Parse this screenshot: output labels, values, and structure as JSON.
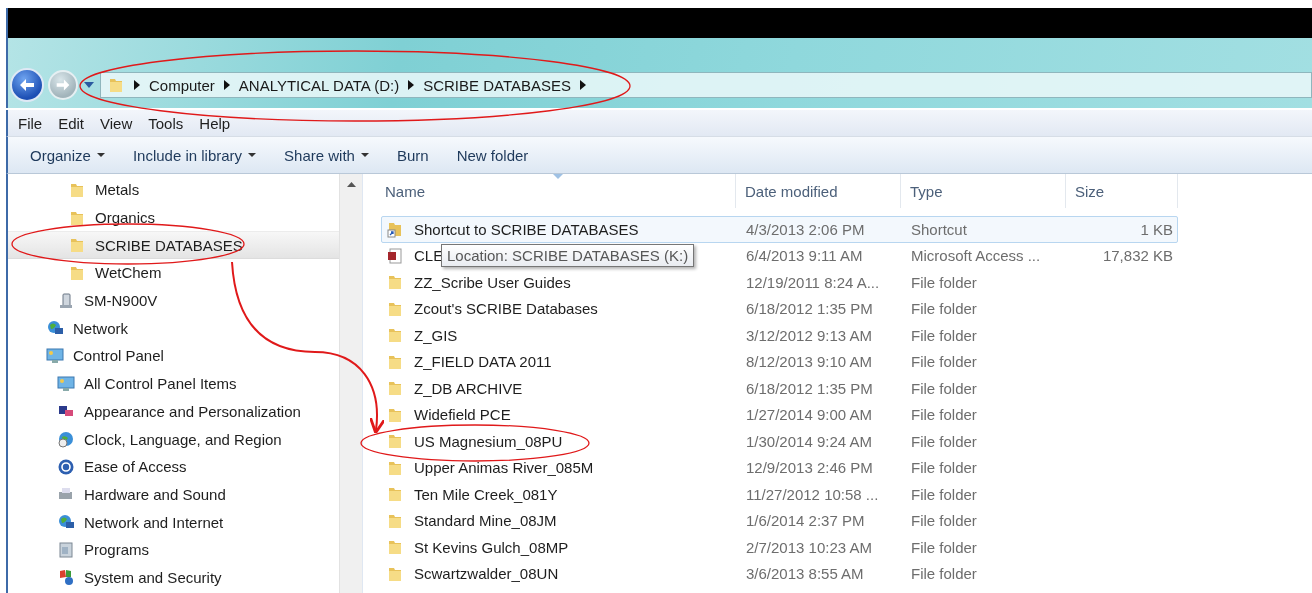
{
  "address_bar": {
    "crumbs": [
      "Computer",
      "ANALYTICAL DATA (D:)",
      "SCRIBE DATABASES"
    ]
  },
  "menu_bar": [
    "File",
    "Edit",
    "View",
    "Tools",
    "Help"
  ],
  "command_bar": [
    {
      "label": "Organize",
      "dropdown": true
    },
    {
      "label": "Include in library",
      "dropdown": true
    },
    {
      "label": "Share with",
      "dropdown": true
    },
    {
      "label": "Burn",
      "dropdown": false
    },
    {
      "label": "New folder",
      "dropdown": false
    }
  ],
  "nav_tree": [
    {
      "kind": "group",
      "children": [
        {
          "kind": "group",
          "children": [
            {
              "kind": "folder",
              "label": "Metals",
              "selected": false
            },
            {
              "kind": "folder",
              "label": "Organics",
              "selected": false
            },
            {
              "kind": "folder",
              "label": "SCRIBE DATABASES",
              "selected": true
            },
            {
              "kind": "folder",
              "label": "WetChem",
              "selected": false
            }
          ]
        },
        {
          "kind": "device",
          "label": "SM-N900V",
          "selected": false
        }
      ]
    },
    {
      "kind": "network",
      "label": "Network",
      "selected": false
    },
    {
      "kind": "panel",
      "label": "Control Panel",
      "selected": false,
      "children": [
        {
          "kind": "panel",
          "label": "All Control Panel Items",
          "selected": false
        },
        {
          "kind": "appearance",
          "label": "Appearance and Personalization",
          "selected": false
        },
        {
          "kind": "clock",
          "label": "Clock, Language, and Region",
          "selected": false
        },
        {
          "kind": "access",
          "label": "Ease of Access",
          "selected": false
        },
        {
          "kind": "hardware",
          "label": "Hardware and Sound",
          "selected": false
        },
        {
          "kind": "internet",
          "label": "Network and Internet",
          "selected": false
        },
        {
          "kind": "programs",
          "label": "Programs",
          "selected": false
        },
        {
          "kind": "security",
          "label": "System and Security",
          "selected": false
        }
      ]
    }
  ],
  "table": {
    "columns": [
      "Name",
      "Date modified",
      "Type",
      "Size"
    ],
    "rows": [
      {
        "kind": "shortcut",
        "name": "Shortcut to SCRIBE DATABASES",
        "date": "4/3/2013 2:06 PM",
        "type": "Shortcut",
        "size": "1 KB",
        "selected": true
      },
      {
        "kind": "access-db",
        "name": "CLE",
        "date": "6/4/2013 9:11 AM",
        "type": "Microsoft Access ...",
        "size": "17,832 KB",
        "selected": false
      },
      {
        "kind": "folder",
        "name": "ZZ_Scribe User Guides",
        "date": "12/19/2011 8:24 A...",
        "type": "File folder",
        "selected": false
      },
      {
        "kind": "folder",
        "name": "Zcout's SCRIBE Databases",
        "date": "6/18/2012 1:35 PM",
        "type": "File folder",
        "selected": false
      },
      {
        "kind": "folder",
        "name": "Z_GIS",
        "date": "3/12/2012 9:13 AM",
        "type": "File folder",
        "selected": false
      },
      {
        "kind": "folder",
        "name": "Z_FIELD DATA 2011",
        "date": "8/12/2013 9:10 AM",
        "type": "File folder",
        "selected": false
      },
      {
        "kind": "folder",
        "name": "Z_DB ARCHIVE",
        "date": "6/18/2012 1:35 PM",
        "type": "File folder",
        "selected": false
      },
      {
        "kind": "folder",
        "name": "Widefield PCE",
        "date": "1/27/2014 9:00 AM",
        "type": "File folder",
        "selected": false
      },
      {
        "kind": "folder",
        "name": "US Magnesium_08PU",
        "date": "1/30/2014 9:24 AM",
        "type": "File folder",
        "selected": false
      },
      {
        "kind": "folder",
        "name": "Upper Animas River_085M",
        "date": "12/9/2013 2:46 PM",
        "type": "File folder",
        "selected": false
      },
      {
        "kind": "folder",
        "name": "Ten Mile Creek_081Y",
        "date": "11/27/2012 10:58 ...",
        "type": "File folder",
        "selected": false
      },
      {
        "kind": "folder",
        "name": "Standard Mine_08JM",
        "date": "1/6/2014 2:37 PM",
        "type": "File folder",
        "selected": false
      },
      {
        "kind": "folder",
        "name": "St Kevins Gulch_08MP",
        "date": "2/7/2013 10:23 AM",
        "type": "File folder",
        "selected": false
      },
      {
        "kind": "folder",
        "name": "Scwartzwalder_08UN",
        "date": "3/6/2013 8:55 AM",
        "type": "File folder",
        "selected": false
      }
    ]
  },
  "tooltip": {
    "text": "Location: SCRIBE DATABASES (K:)"
  },
  "annotations": [
    {
      "kind": "ellipse"
    },
    {
      "kind": "ellipse"
    },
    {
      "kind": "arrow"
    },
    {
      "kind": "ellipse"
    }
  ]
}
